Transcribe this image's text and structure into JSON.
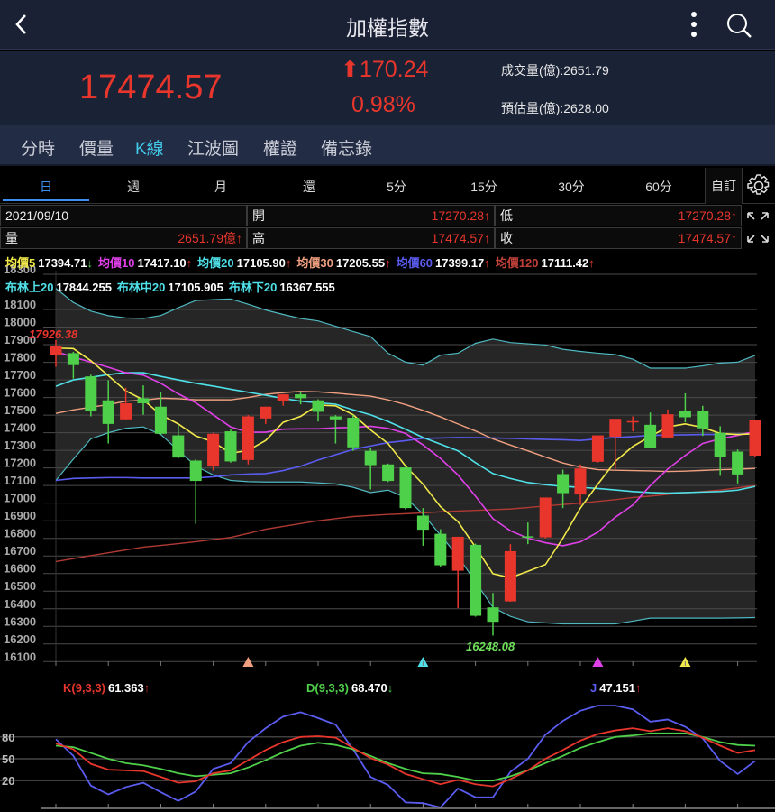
{
  "header": {
    "title": "加權指數",
    "back_icon": "chevron-left-icon",
    "more_icon": "kebab-icon",
    "search_icon": "search-icon"
  },
  "quote": {
    "price": "17474.57",
    "change": "170.24",
    "change_pct": "0.98%",
    "volume_label": "成交量(億):2651.79",
    "est_volume_label": "預估量(億):2628.00",
    "up_color": "#e8362c"
  },
  "tabs": [
    {
      "label": "分時"
    },
    {
      "label": "價量"
    },
    {
      "label": "K線",
      "active": true
    },
    {
      "label": "江波圖"
    },
    {
      "label": "權證"
    },
    {
      "label": "備忘錄"
    }
  ],
  "periods": [
    {
      "label": "日",
      "active": true
    },
    {
      "label": "週"
    },
    {
      "label": "月"
    },
    {
      "label": "還"
    },
    {
      "label": "5分"
    },
    {
      "label": "15分"
    },
    {
      "label": "30分"
    },
    {
      "label": "60分"
    }
  ],
  "custom_label": "自訂",
  "info": {
    "date": "2021/09/10",
    "open_label": "開",
    "open": "17270.28↑",
    "low_label": "低",
    "low": "17270.28↑",
    "vol_label": "量",
    "vol": "2651.79億↑",
    "high_label": "高",
    "high": "17474.57↑",
    "close_label": "收",
    "close": "17474.57↑"
  },
  "ma_legend": [
    {
      "label": "均價5",
      "value": "17394.71",
      "arrow": "↓",
      "color": "#f2e94a",
      "arrow_color": "#4fd04a"
    },
    {
      "label": "均價10",
      "value": "17417.10",
      "arrow": "↑",
      "color": "#e040e8",
      "arrow_color": "#e8362c"
    },
    {
      "label": "均價20",
      "value": "17105.90",
      "arrow": "↑",
      "color": "#4fe0e8",
      "arrow_color": "#e8362c"
    },
    {
      "label": "均價30",
      "value": "17205.55",
      "arrow": "↑",
      "color": "#f0a080",
      "arrow_color": "#e8362c"
    },
    {
      "label": "均價60",
      "value": "17399.17",
      "arrow": "↑",
      "color": "#5a5cf0",
      "arrow_color": "#e8362c"
    },
    {
      "label": "均價120",
      "value": "17111.42",
      "arrow": "↑",
      "color": "#c0403a",
      "arrow_color": "#e8362c"
    }
  ],
  "boll_legend": [
    {
      "label": "布林上20",
      "value": "17844.255",
      "color": "#4fe0e8"
    },
    {
      "label": "布林中20",
      "value": "17105.905",
      "color": "#4fe0e8"
    },
    {
      "label": "布林下20",
      "value": "16367.555",
      "color": "#4fe0e8"
    }
  ],
  "kdj_legend": [
    {
      "label": "K(9,3,3)",
      "value": "61.363",
      "arrow": "↑",
      "color": "#e8362c",
      "arrow_color": "#e8362c"
    },
    {
      "label": "D(9,3,3)",
      "value": "68.470",
      "arrow": "↓",
      "color": "#4fd04a",
      "arrow_color": "#4fd04a"
    },
    {
      "label": "J",
      "value": "47.151",
      "arrow": "↑",
      "color": "#5a5cf0",
      "arrow_color": "#e8362c"
    }
  ],
  "chart_data": {
    "type": "candlestick",
    "ylim": [
      16100,
      18300
    ],
    "yticks": [
      "18300",
      "18100",
      "18000",
      "17900",
      "17800",
      "17700",
      "17600",
      "17500",
      "17400",
      "17300",
      "17200",
      "17100",
      "17000",
      "16900",
      "16800",
      "16700",
      "16600",
      "16500",
      "16400",
      "16300",
      "16200",
      "16100"
    ],
    "max_label": "17926.38",
    "min_label": "16248.08",
    "candles_ohlc": [
      [
        17840,
        17926,
        17775,
        17890
      ],
      [
        17852,
        17860,
        17707,
        17784
      ],
      [
        17720,
        17730,
        17493,
        17522
      ],
      [
        17584,
        17698,
        17339,
        17450
      ],
      [
        17476,
        17656,
        17470,
        17567
      ],
      [
        17596,
        17669,
        17502,
        17567
      ],
      [
        17548,
        17630,
        17390,
        17394
      ],
      [
        17385,
        17442,
        17255,
        17259
      ],
      [
        17242,
        17250,
        16883,
        17126
      ],
      [
        17208,
        17400,
        17185,
        17394
      ],
      [
        17408,
        17420,
        17230,
        17237
      ],
      [
        17245,
        17500,
        17220,
        17493
      ],
      [
        17481,
        17548,
        17450,
        17548
      ],
      [
        17582,
        17620,
        17553,
        17618
      ],
      [
        17618,
        17630,
        17561,
        17596
      ],
      [
        17584,
        17590,
        17464,
        17519
      ],
      [
        17493,
        17500,
        17339,
        17476
      ],
      [
        17485,
        17500,
        17297,
        17317
      ],
      [
        17297,
        17314,
        17078,
        17216
      ],
      [
        17220,
        17225,
        17120,
        17126
      ],
      [
        17203,
        17210,
        16965,
        16972
      ],
      [
        16929,
        16972,
        16758,
        16849
      ],
      [
        16826,
        16852,
        16640,
        16647
      ],
      [
        16616,
        16809,
        16404,
        16809
      ],
      [
        16763,
        16770,
        16355,
        16360
      ],
      [
        16408,
        16490,
        16248,
        16326
      ],
      [
        16442,
        16767,
        16440,
        16727
      ],
      [
        16812,
        16890,
        16767,
        16806
      ],
      [
        16806,
        17032,
        16800,
        17032
      ],
      [
        17165,
        17190,
        16972,
        17057
      ],
      [
        17049,
        17220,
        16989,
        17197
      ],
      [
        17235,
        17385,
        17230,
        17385
      ],
      [
        17377,
        17479,
        17194,
        17479
      ],
      [
        17464,
        17493,
        17408,
        17466
      ],
      [
        17445,
        17515,
        17314,
        17314
      ],
      [
        17373,
        17532,
        17370,
        17505
      ],
      [
        17524,
        17624,
        17459,
        17488
      ],
      [
        17524,
        17553,
        17382,
        17425
      ],
      [
        17399,
        17437,
        17155,
        17262
      ],
      [
        17293,
        17305,
        17112,
        17163
      ],
      [
        17270,
        17474,
        17262,
        17474
      ]
    ],
    "ma5": [
      17881,
      17878,
      17809,
      17724,
      17638,
      17587,
      17502,
      17450,
      17382,
      17348,
      17283,
      17300,
      17356,
      17459,
      17493,
      17557,
      17553,
      17502,
      17416,
      17339,
      17211,
      17108,
      16980,
      16895,
      16750,
      16599,
      16576,
      16613,
      16651,
      16801,
      16972,
      17108,
      17237,
      17322,
      17379,
      17433,
      17450,
      17430,
      17396,
      17390,
      17394
    ],
    "ma10": [
      17861,
      17830,
      17801,
      17772,
      17741,
      17727,
      17681,
      17621,
      17570,
      17502,
      17433,
      17403,
      17403,
      17420,
      17422,
      17422,
      17428,
      17430,
      17437,
      17425,
      17396,
      17331,
      17254,
      17160,
      17040,
      16912,
      16843,
      16801,
      16775,
      16758,
      16780,
      16835,
      16920,
      16989,
      17100,
      17194,
      17271,
      17339,
      17365,
      17385,
      17408
    ],
    "ma20": [
      17664,
      17700,
      17715,
      17730,
      17741,
      17741,
      17720,
      17700,
      17681,
      17665,
      17647,
      17630,
      17613,
      17595,
      17579,
      17570,
      17562,
      17530,
      17502,
      17464,
      17420,
      17373,
      17335,
      17297,
      17230,
      17168,
      17140,
      17117,
      17105,
      17095,
      17090,
      17083,
      17075,
      17066,
      17060,
      17057,
      17060,
      17063,
      17066,
      17074,
      17095
    ],
    "ma30": [
      17510,
      17530,
      17545,
      17560,
      17579,
      17585,
      17596,
      17593,
      17587,
      17587,
      17587,
      17600,
      17618,
      17628,
      17635,
      17632,
      17625,
      17616,
      17608,
      17587,
      17560,
      17527,
      17490,
      17450,
      17410,
      17365,
      17330,
      17297,
      17262,
      17228,
      17205,
      17190,
      17187,
      17185,
      17183,
      17180,
      17182,
      17186,
      17190,
      17193,
      17197
    ],
    "ma60": [
      17129,
      17140,
      17143,
      17145,
      17145,
      17143,
      17143,
      17143,
      17143,
      17150,
      17160,
      17165,
      17168,
      17185,
      17210,
      17245,
      17275,
      17305,
      17325,
      17344,
      17355,
      17368,
      17370,
      17373,
      17372,
      17370,
      17368,
      17365,
      17362,
      17360,
      17356,
      17365,
      17373,
      17378,
      17385,
      17387,
      17388,
      17390,
      17390,
      17392,
      17395
    ],
    "ma120": [
      16668,
      16685,
      16702,
      16718,
      16734,
      16750,
      16760,
      16770,
      16781,
      16793,
      16805,
      16828,
      16852,
      16868,
      16884,
      16900,
      16912,
      16924,
      16930,
      16936,
      16940,
      16945,
      16951,
      16955,
      16959,
      16963,
      16967,
      16975,
      16984,
      16992,
      17000,
      17010,
      17020,
      17032,
      17040,
      17050,
      17058,
      17066,
      17074,
      17087,
      17100
    ],
    "boll_upper": [
      18220,
      18140,
      18091,
      18065,
      18052,
      18049,
      18066,
      18110,
      18151,
      18156,
      18160,
      18130,
      18097,
      18072,
      18049,
      18035,
      18005,
      17975,
      17946,
      17852,
      17801,
      17784,
      17840,
      17852,
      17908,
      17932,
      17912,
      17905,
      17898,
      17874,
      17862,
      17852,
      17844,
      17818,
      17767,
      17767,
      17767,
      17780,
      17796,
      17801,
      17840
    ],
    "boll_lower": [
      17129,
      17250,
      17365,
      17400,
      17425,
      17433,
      17390,
      17300,
      17211,
      17160,
      17129,
      17122,
      17120,
      17120,
      17120,
      17115,
      17109,
      17090,
      17060,
      17074,
      17032,
      16938,
      16818,
      16698,
      16553,
      16408,
      16357,
      16326,
      16320,
      16314,
      16314,
      16314,
      16314,
      16330,
      16347,
      16347,
      16347,
      16347,
      16347,
      16348,
      16350
    ],
    "signals": [
      {
        "index": 11,
        "color": "#f0a080"
      },
      {
        "index": 21,
        "color": "#4fe0e8"
      },
      {
        "index": 31,
        "color": "#e040e8"
      },
      {
        "index": 36,
        "color": "#f2e94a"
      }
    ],
    "kdj": {
      "yticks": [
        "80",
        "50",
        "20"
      ],
      "k": [
        71,
        63,
        43,
        35,
        34,
        33,
        25,
        17,
        19,
        30,
        34,
        48,
        62,
        73,
        80,
        81,
        79,
        65,
        51,
        42,
        29,
        22,
        15,
        21,
        15,
        12,
        22,
        34,
        50,
        62,
        75,
        84,
        89,
        92,
        88,
        92,
        88,
        79,
        68,
        58,
        62
      ],
      "d": [
        68,
        66,
        58,
        50,
        44,
        41,
        36,
        30,
        26,
        28,
        30,
        38,
        48,
        59,
        68,
        72,
        69,
        63,
        54,
        44,
        36,
        30,
        29,
        25,
        20,
        20,
        26,
        34,
        44,
        54,
        65,
        73,
        80,
        82,
        85,
        85,
        85,
        80,
        73,
        69,
        68
      ],
      "j": [
        77,
        54,
        13,
        1,
        11,
        17,
        4,
        -8,
        5,
        36,
        44,
        73,
        92,
        108,
        114,
        106,
        97,
        63,
        25,
        14,
        -10,
        -11,
        -17,
        9,
        -3,
        -3,
        32,
        50,
        83,
        102,
        116,
        123,
        123,
        118,
        101,
        104,
        94,
        78,
        47,
        29,
        47
      ]
    }
  }
}
